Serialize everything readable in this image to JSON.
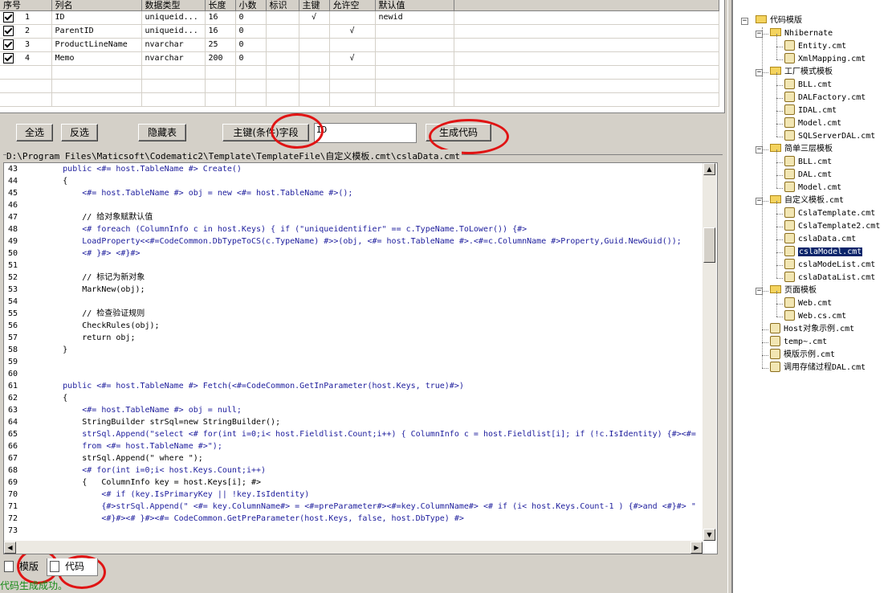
{
  "grid": {
    "columns": [
      "序号",
      "列名",
      "数据类型",
      "长度",
      "小数",
      "标识",
      "主键",
      "允许空",
      "默认值"
    ],
    "rows": [
      {
        "checked": true,
        "index": "1",
        "name": "ID",
        "type": "uniqueid...",
        "length": "16",
        "decimal": "0",
        "identity": "",
        "pk": "√",
        "nullable": "",
        "default": "newid"
      },
      {
        "checked": true,
        "index": "2",
        "name": "ParentID",
        "type": "uniqueid...",
        "length": "16",
        "decimal": "0",
        "identity": "",
        "pk": "",
        "nullable": "√",
        "default": ""
      },
      {
        "checked": true,
        "index": "3",
        "name": "ProductLineName",
        "type": "nvarchar",
        "length": "25",
        "decimal": "0",
        "identity": "",
        "pk": "",
        "nullable": "",
        "default": ""
      },
      {
        "checked": true,
        "index": "4",
        "name": "Memo",
        "type": "nvarchar",
        "length": "200",
        "decimal": "0",
        "identity": "",
        "pk": "",
        "nullable": "√",
        "default": ""
      }
    ]
  },
  "toolbar": {
    "select_all": "全选",
    "invert": "反选",
    "hide_table": "隐藏表",
    "pk_fields": "主键(条件)字段",
    "pk_value": "ID",
    "generate": "生成代码"
  },
  "path": "D:\\Program Files\\Maticsoft\\Codematic2\\Template\\TemplateFile\\自定义模板.cmt\\cslaData.cmt",
  "code": [
    {
      "n": "43",
      "t": "        public <#= host.TableName #> Create()"
    },
    {
      "n": "44",
      "t": "        {"
    },
    {
      "n": "45",
      "t": "            <#= host.TableName #> obj = new <#= host.TableName #>();"
    },
    {
      "n": "46",
      "t": ""
    },
    {
      "n": "47",
      "t": "            // 给对象赋默认值"
    },
    {
      "n": "48",
      "t": "            <# foreach (ColumnInfo c in host.Keys) { if (\"uniqueidentifier\" == c.TypeName.ToLower()) {#>"
    },
    {
      "n": "49",
      "t": "            LoadProperty<<#=CodeCommon.DbTypeToCS(c.TypeName) #>>(obj, <#= host.TableName #>.<#=c.ColumnName #>Property,Guid.NewGuid());"
    },
    {
      "n": "50",
      "t": "            <# }#> <#}#>"
    },
    {
      "n": "51",
      "t": ""
    },
    {
      "n": "52",
      "t": "            // 标记为新对象"
    },
    {
      "n": "53",
      "t": "            MarkNew(obj);"
    },
    {
      "n": "54",
      "t": ""
    },
    {
      "n": "55",
      "t": "            // 检查验证规则"
    },
    {
      "n": "56",
      "t": "            CheckRules(obj);"
    },
    {
      "n": "57",
      "t": "            return obj;"
    },
    {
      "n": "58",
      "t": "        }"
    },
    {
      "n": "59",
      "t": ""
    },
    {
      "n": "60",
      "t": ""
    },
    {
      "n": "61",
      "t": "        public <#= host.TableName #> Fetch(<#=CodeCommon.GetInParameter(host.Keys, true)#>)"
    },
    {
      "n": "62",
      "t": "        {"
    },
    {
      "n": "63",
      "t": "            <#= host.TableName #> obj = null;"
    },
    {
      "n": "64",
      "t": "            StringBuilder strSql=new StringBuilder();"
    },
    {
      "n": "65",
      "t": "            strSql.Append(\"select <# for(int i=0;i< host.Fieldlist.Count;i++) { ColumnInfo c = host.Fieldlist[i]; if (!c.IsIdentity) {#><#="
    },
    {
      "n": "66",
      "t": "            from <#= host.TableName #>\");"
    },
    {
      "n": "67",
      "t": "            strSql.Append(\" where \");"
    },
    {
      "n": "68",
      "t": "            <# for(int i=0;i< host.Keys.Count;i++)"
    },
    {
      "n": "69",
      "t": "            {   ColumnInfo key = host.Keys[i]; #>"
    },
    {
      "n": "70",
      "t": "                <# if (key.IsPrimaryKey || !key.IsIdentity)"
    },
    {
      "n": "71",
      "t": "                {#>strSql.Append(\" <#= key.ColumnName#> = <#=preParameter#><#=key.ColumnName#> <# if (i< host.Keys.Count-1 ) {#>and <#}#> \""
    },
    {
      "n": "72",
      "t": "                <#}#><# }#><#= CodeCommon.GetPreParameter(host.Keys, false, host.DbType) #>"
    },
    {
      "n": "73",
      "t": ""
    }
  ],
  "tabs": {
    "template": "模版",
    "code": "代码"
  },
  "status": "代码生成成功。",
  "tree": {
    "root": "代码模版",
    "groups": [
      {
        "name": "Nhibernate",
        "items": [
          "Entity.cmt",
          "XmlMapping.cmt"
        ]
      },
      {
        "name": "工厂模式模板",
        "items": [
          "BLL.cmt",
          "DALFactory.cmt",
          "IDAL.cmt",
          "Model.cmt",
          "SQLServerDAL.cmt"
        ]
      },
      {
        "name": "简单三层模板",
        "items": [
          "BLL.cmt",
          "DAL.cmt",
          "Model.cmt"
        ]
      },
      {
        "name": "自定义模板.cmt",
        "items": [
          "CslaTemplate.cmt",
          "CslaTemplate2.cmt",
          "cslaData.cmt",
          "cslaModel.cmt",
          "cslaModeList.cmt",
          "cslaDataList.cmt"
        ]
      },
      {
        "name": "页面模板",
        "items": [
          "Web.cmt",
          "Web.cs.cmt"
        ]
      }
    ],
    "root_items": [
      "Host对象示例.cmt",
      "temp~.cmt",
      "模版示例.cmt",
      "调用存储过程DAL.cmt"
    ],
    "selected": "cslaModel.cmt"
  }
}
